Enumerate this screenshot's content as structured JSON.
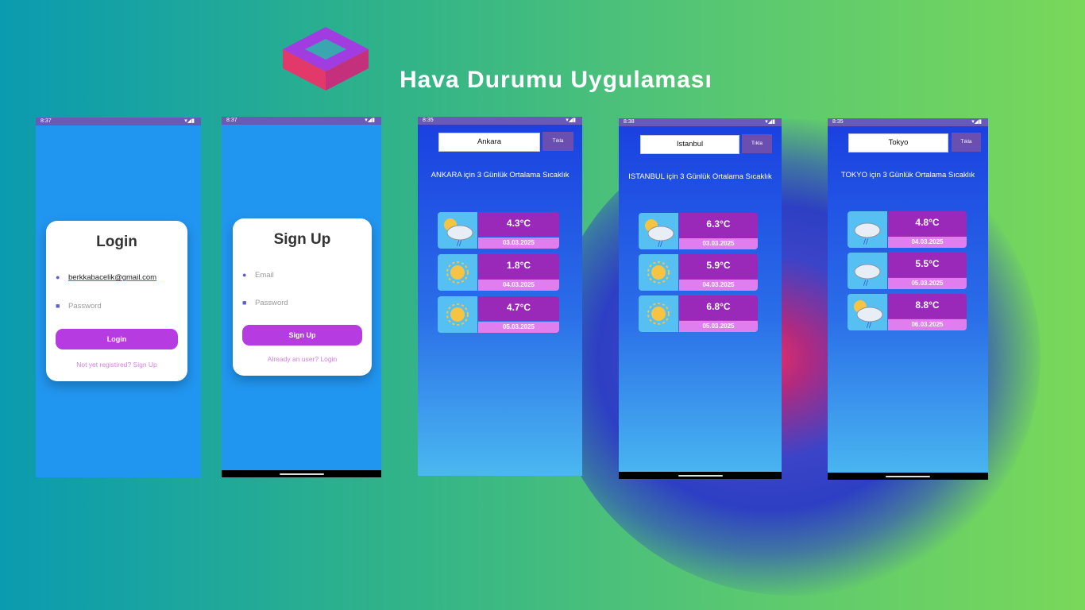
{
  "header": {
    "title": "Hava Durumu Uygulaması"
  },
  "login": {
    "status_time": "8:37",
    "title": "Login",
    "email_value": "berkkabacelik@gmail.com",
    "password_placeholder": "Password",
    "button": "Login",
    "link": "Not yet registired? Sign Up"
  },
  "signup": {
    "status_time": "8:37",
    "title": "Sign Up",
    "email_placeholder": "Email",
    "password_placeholder": "Password",
    "button": "Sign Up",
    "link": "Already an user? Login"
  },
  "weather": [
    {
      "status_time": "8:35",
      "city_input": "Ankara",
      "button": "Tıkla",
      "heading": "ANKARA  için 3 Günlük Ortalama Sıcaklık",
      "days": [
        {
          "temp": "4.3°C",
          "date": "03.03.2025",
          "icon": "sun-cloud-rain-icon"
        },
        {
          "temp": "1.8°C",
          "date": "04.03.2025",
          "icon": "sun-icon"
        },
        {
          "temp": "4.7°C",
          "date": "05.03.2025",
          "icon": "sun-icon"
        }
      ]
    },
    {
      "status_time": "8:38",
      "city_input": "Istanbul",
      "button": "Tıkla",
      "heading": "ISTANBUL  için 3 Günlük Ortalama Sıcaklık",
      "days": [
        {
          "temp": "6.3°C",
          "date": "03.03.2025",
          "icon": "sun-cloud-rain-icon"
        },
        {
          "temp": "5.9°C",
          "date": "04.03.2025",
          "icon": "sun-icon"
        },
        {
          "temp": "6.8°C",
          "date": "05.03.2025",
          "icon": "sun-icon"
        }
      ]
    },
    {
      "status_time": "8:35",
      "city_input": "Tokyo",
      "button": "Tıkla",
      "heading": "TOKYO  için 3 Günlük Ortalama Sıcaklık",
      "days": [
        {
          "temp": "4.8°C",
          "date": "04.03.2025",
          "icon": "cloud-rain-icon"
        },
        {
          "temp": "5.5°C",
          "date": "05.03.2025",
          "icon": "cloud-rain-icon"
        },
        {
          "temp": "8.8°C",
          "date": "06.03.2025",
          "icon": "sun-cloud-rain-icon"
        }
      ]
    }
  ]
}
